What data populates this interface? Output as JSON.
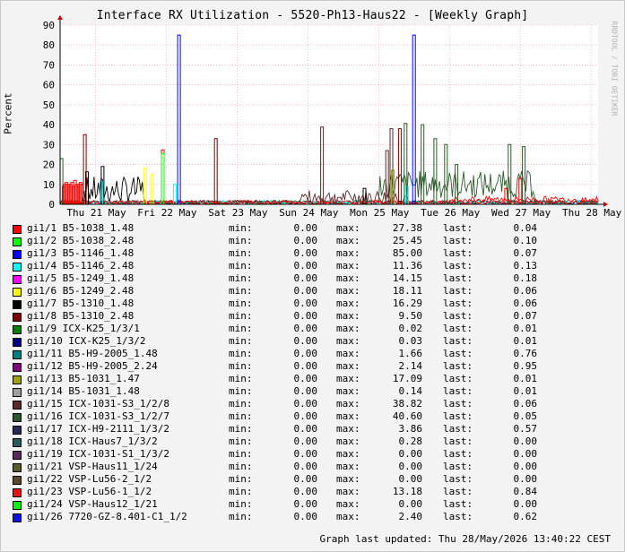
{
  "chart_data": {
    "type": "line",
    "title": "Interface RX Utilization - 5520-Ph13-Haus22 - [Weekly Graph]",
    "ylabel": "Percent",
    "ylim": [
      0,
      90
    ],
    "yticks": [
      0,
      10,
      20,
      30,
      40,
      50,
      60,
      70,
      80,
      90
    ],
    "xticks": [
      "Thu 21 May",
      "Fri 22 May",
      "Sat 23 May",
      "Sun 24 May",
      "Mon 25 May",
      "Tue 26 May",
      "Wed 27 May",
      "Thu 28 May"
    ],
    "grid": true,
    "watermark": "RRDTOOL / TOBI OETIKER",
    "series": [
      {
        "name": "gi1/1 B5-1038_1.48",
        "color": "#ff0000",
        "min": "0.00",
        "max": "27.38",
        "last": "0.04"
      },
      {
        "name": "gi1/2 B5-1038_2.48",
        "color": "#00ff00",
        "min": "0.00",
        "max": "25.45",
        "last": "0.10"
      },
      {
        "name": "gi1/3 B5-1146_1.48",
        "color": "#0000ff",
        "min": "0.00",
        "max": "85.00",
        "last": "0.07"
      },
      {
        "name": "gi1/4 B5-1146_2.48",
        "color": "#00ffff",
        "min": "0.00",
        "max": "11.36",
        "last": "0.13"
      },
      {
        "name": "gi1/5 B5-1249_1.48",
        "color": "#ff00ff",
        "min": "0.00",
        "max": "14.15",
        "last": "0.18"
      },
      {
        "name": "gi1/6 B5-1249_2.48",
        "color": "#ffff00",
        "min": "0.00",
        "max": "18.11",
        "last": "0.06"
      },
      {
        "name": "gi1/7 B5-1310_1.48",
        "color": "#000000",
        "min": "0.00",
        "max": "16.29",
        "last": "0.06"
      },
      {
        "name": "gi1/8 B5-1310_2.48",
        "color": "#800000",
        "min": "0.00",
        "max": "9.50",
        "last": "0.07"
      },
      {
        "name": "gi1/9 ICX-K25_1/3/1",
        "color": "#008000",
        "min": "0.00",
        "max": "0.02",
        "last": "0.01"
      },
      {
        "name": "gi1/10 ICX-K25_1/3/2",
        "color": "#000080",
        "min": "0.00",
        "max": "0.03",
        "last": "0.01"
      },
      {
        "name": "gi1/11 B5-H9-2005_1.48",
        "color": "#008080",
        "min": "0.00",
        "max": "1.66",
        "last": "0.76"
      },
      {
        "name": "gi1/12 B5-H9-2005_2.24",
        "color": "#800080",
        "min": "0.00",
        "max": "2.14",
        "last": "0.95"
      },
      {
        "name": "gi1/13 B5-1031_1.47",
        "color": "#a0a000",
        "min": "0.00",
        "max": "17.09",
        "last": "0.01"
      },
      {
        "name": "gi1/14 B5-1031_1.48",
        "color": "#a0a0a0",
        "min": "0.00",
        "max": "0.14",
        "last": "0.01"
      },
      {
        "name": "gi1/15 ICX-1031-S3_1/2/8",
        "color": "#5a2a2a",
        "min": "0.00",
        "max": "38.82",
        "last": "0.06"
      },
      {
        "name": "gi1/16 ICX-1031-S3_1/2/7",
        "color": "#2a5a2a",
        "min": "0.00",
        "max": "40.60",
        "last": "0.05"
      },
      {
        "name": "gi1/17 ICX-H9-2111_1/3/2",
        "color": "#2a2a5a",
        "min": "0.00",
        "max": "3.86",
        "last": "0.57"
      },
      {
        "name": "gi1/18 ICX-Haus7_1/3/2",
        "color": "#2a5a5a",
        "min": "0.00",
        "max": "0.28",
        "last": "0.00"
      },
      {
        "name": "gi1/19 ICX-1031-S1_1/3/2",
        "color": "#5a2a5a",
        "min": "0.00",
        "max": "0.00",
        "last": "0.00"
      },
      {
        "name": "gi1/21 VSP-Haus11_1/24",
        "color": "#5a5a2a",
        "min": "0.00",
        "max": "0.00",
        "last": "0.00"
      },
      {
        "name": "gi1/22 VSP-Lu56-2_1/2",
        "color": "#5a4a2a",
        "min": "0.00",
        "max": "0.00",
        "last": "0.00"
      },
      {
        "name": "gi1/23 VSP-Lu56-1_1/2",
        "color": "#ee1111",
        "min": "0.00",
        "max": "13.18",
        "last": "0.84"
      },
      {
        "name": "gi1/24 VSP-Haus12_1/21",
        "color": "#11ee11",
        "min": "0.00",
        "max": "0.00",
        "last": "0.00"
      },
      {
        "name": "gi1/26 7720-GZ-8.401-C1_1/2",
        "color": "#1111ee",
        "min": "0.00",
        "max": "2.40",
        "last": "0.62"
      }
    ],
    "spikes": [
      {
        "series": 0,
        "x": 0.05,
        "y": 9
      },
      {
        "series": 0,
        "x": 0.07,
        "y": 10
      },
      {
        "series": 0,
        "x": 0.09,
        "y": 11
      },
      {
        "series": 0,
        "x": 0.11,
        "y": 10
      },
      {
        "series": 0,
        "x": 0.13,
        "y": 9
      },
      {
        "series": 0,
        "x": 0.15,
        "y": 10
      },
      {
        "series": 0,
        "x": 0.17,
        "y": 11
      },
      {
        "series": 0,
        "x": 0.19,
        "y": 9
      },
      {
        "series": 0,
        "x": 0.21,
        "y": 12
      },
      {
        "series": 0,
        "x": 0.23,
        "y": 10
      },
      {
        "series": 0,
        "x": 0.25,
        "y": 9
      },
      {
        "series": 0,
        "x": 0.27,
        "y": 10
      },
      {
        "series": 0,
        "x": 0.29,
        "y": 11
      },
      {
        "series": 0,
        "x": 0.31,
        "y": 10
      },
      {
        "series": 0,
        "x": 1.45,
        "y": 27.38
      },
      {
        "series": 0,
        "x": 6.3,
        "y": 8
      },
      {
        "series": 1,
        "x": 1.45,
        "y": 25.45
      },
      {
        "series": 2,
        "x": 1.68,
        "y": 85.0
      },
      {
        "series": 2,
        "x": 5.0,
        "y": 85.0
      },
      {
        "series": 3,
        "x": 0.58,
        "y": 11.36
      },
      {
        "series": 3,
        "x": 1.62,
        "y": 10
      },
      {
        "series": 3,
        "x": 4.9,
        "y": 9
      },
      {
        "series": 5,
        "x": 1.2,
        "y": 18.11
      },
      {
        "series": 5,
        "x": 1.3,
        "y": 15
      },
      {
        "series": 6,
        "x": 0.38,
        "y": 16.29
      },
      {
        "series": 6,
        "x": 0.6,
        "y": 19
      },
      {
        "series": 6,
        "x": 4.3,
        "y": 8
      },
      {
        "series": 7,
        "x": 0.35,
        "y": 35
      },
      {
        "series": 7,
        "x": 2.2,
        "y": 33
      },
      {
        "series": 7,
        "x": 4.8,
        "y": 38
      },
      {
        "series": 12,
        "x": 4.7,
        "y": 17.09
      },
      {
        "series": 14,
        "x": 3.7,
        "y": 38.82
      },
      {
        "series": 14,
        "x": 4.62,
        "y": 27
      },
      {
        "series": 14,
        "x": 4.68,
        "y": 38
      },
      {
        "series": 15,
        "x": 4.88,
        "y": 40.6
      },
      {
        "series": 15,
        "x": 5.12,
        "y": 40
      },
      {
        "series": 15,
        "x": 5.3,
        "y": 33
      },
      {
        "series": 15,
        "x": 5.45,
        "y": 30
      },
      {
        "series": 15,
        "x": 5.6,
        "y": 20
      },
      {
        "series": 15,
        "x": 6.35,
        "y": 30
      },
      {
        "series": 15,
        "x": 6.55,
        "y": 29
      },
      {
        "series": 15,
        "x": 0.02,
        "y": 23
      },
      {
        "series": 21,
        "x": 6.5,
        "y": 13.18
      }
    ]
  },
  "legend_labels": {
    "min": "min:",
    "max": "max:",
    "last": "last:"
  },
  "footer": "Graph last updated: Thu 28/May/2026 13:40:22 CEST"
}
